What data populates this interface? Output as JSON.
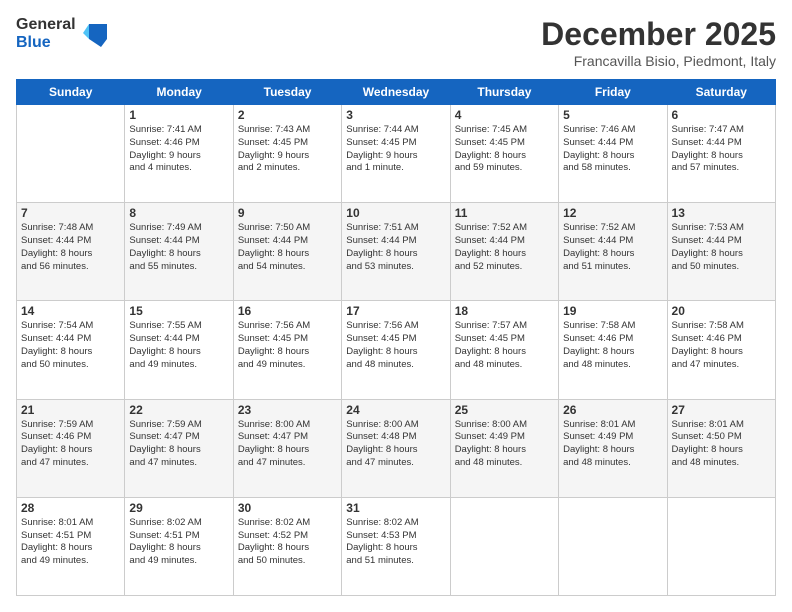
{
  "logo": {
    "general": "General",
    "blue": "Blue"
  },
  "header": {
    "month": "December 2025",
    "location": "Francavilla Bisio, Piedmont, Italy"
  },
  "weekdays": [
    "Sunday",
    "Monday",
    "Tuesday",
    "Wednesday",
    "Thursday",
    "Friday",
    "Saturday"
  ],
  "weeks": [
    [
      {
        "day": "",
        "info": ""
      },
      {
        "day": "1",
        "info": "Sunrise: 7:41 AM\nSunset: 4:46 PM\nDaylight: 9 hours\nand 4 minutes."
      },
      {
        "day": "2",
        "info": "Sunrise: 7:43 AM\nSunset: 4:45 PM\nDaylight: 9 hours\nand 2 minutes."
      },
      {
        "day": "3",
        "info": "Sunrise: 7:44 AM\nSunset: 4:45 PM\nDaylight: 9 hours\nand 1 minute."
      },
      {
        "day": "4",
        "info": "Sunrise: 7:45 AM\nSunset: 4:45 PM\nDaylight: 8 hours\nand 59 minutes."
      },
      {
        "day": "5",
        "info": "Sunrise: 7:46 AM\nSunset: 4:44 PM\nDaylight: 8 hours\nand 58 minutes."
      },
      {
        "day": "6",
        "info": "Sunrise: 7:47 AM\nSunset: 4:44 PM\nDaylight: 8 hours\nand 57 minutes."
      }
    ],
    [
      {
        "day": "7",
        "info": "Sunrise: 7:48 AM\nSunset: 4:44 PM\nDaylight: 8 hours\nand 56 minutes."
      },
      {
        "day": "8",
        "info": "Sunrise: 7:49 AM\nSunset: 4:44 PM\nDaylight: 8 hours\nand 55 minutes."
      },
      {
        "day": "9",
        "info": "Sunrise: 7:50 AM\nSunset: 4:44 PM\nDaylight: 8 hours\nand 54 minutes."
      },
      {
        "day": "10",
        "info": "Sunrise: 7:51 AM\nSunset: 4:44 PM\nDaylight: 8 hours\nand 53 minutes."
      },
      {
        "day": "11",
        "info": "Sunrise: 7:52 AM\nSunset: 4:44 PM\nDaylight: 8 hours\nand 52 minutes."
      },
      {
        "day": "12",
        "info": "Sunrise: 7:52 AM\nSunset: 4:44 PM\nDaylight: 8 hours\nand 51 minutes."
      },
      {
        "day": "13",
        "info": "Sunrise: 7:53 AM\nSunset: 4:44 PM\nDaylight: 8 hours\nand 50 minutes."
      }
    ],
    [
      {
        "day": "14",
        "info": "Sunrise: 7:54 AM\nSunset: 4:44 PM\nDaylight: 8 hours\nand 50 minutes."
      },
      {
        "day": "15",
        "info": "Sunrise: 7:55 AM\nSunset: 4:44 PM\nDaylight: 8 hours\nand 49 minutes."
      },
      {
        "day": "16",
        "info": "Sunrise: 7:56 AM\nSunset: 4:45 PM\nDaylight: 8 hours\nand 49 minutes."
      },
      {
        "day": "17",
        "info": "Sunrise: 7:56 AM\nSunset: 4:45 PM\nDaylight: 8 hours\nand 48 minutes."
      },
      {
        "day": "18",
        "info": "Sunrise: 7:57 AM\nSunset: 4:45 PM\nDaylight: 8 hours\nand 48 minutes."
      },
      {
        "day": "19",
        "info": "Sunrise: 7:58 AM\nSunset: 4:46 PM\nDaylight: 8 hours\nand 48 minutes."
      },
      {
        "day": "20",
        "info": "Sunrise: 7:58 AM\nSunset: 4:46 PM\nDaylight: 8 hours\nand 47 minutes."
      }
    ],
    [
      {
        "day": "21",
        "info": "Sunrise: 7:59 AM\nSunset: 4:46 PM\nDaylight: 8 hours\nand 47 minutes."
      },
      {
        "day": "22",
        "info": "Sunrise: 7:59 AM\nSunset: 4:47 PM\nDaylight: 8 hours\nand 47 minutes."
      },
      {
        "day": "23",
        "info": "Sunrise: 8:00 AM\nSunset: 4:47 PM\nDaylight: 8 hours\nand 47 minutes."
      },
      {
        "day": "24",
        "info": "Sunrise: 8:00 AM\nSunset: 4:48 PM\nDaylight: 8 hours\nand 47 minutes."
      },
      {
        "day": "25",
        "info": "Sunrise: 8:00 AM\nSunset: 4:49 PM\nDaylight: 8 hours\nand 48 minutes."
      },
      {
        "day": "26",
        "info": "Sunrise: 8:01 AM\nSunset: 4:49 PM\nDaylight: 8 hours\nand 48 minutes."
      },
      {
        "day": "27",
        "info": "Sunrise: 8:01 AM\nSunset: 4:50 PM\nDaylight: 8 hours\nand 48 minutes."
      }
    ],
    [
      {
        "day": "28",
        "info": "Sunrise: 8:01 AM\nSunset: 4:51 PM\nDaylight: 8 hours\nand 49 minutes."
      },
      {
        "day": "29",
        "info": "Sunrise: 8:02 AM\nSunset: 4:51 PM\nDaylight: 8 hours\nand 49 minutes."
      },
      {
        "day": "30",
        "info": "Sunrise: 8:02 AM\nSunset: 4:52 PM\nDaylight: 8 hours\nand 50 minutes."
      },
      {
        "day": "31",
        "info": "Sunrise: 8:02 AM\nSunset: 4:53 PM\nDaylight: 8 hours\nand 51 minutes."
      },
      {
        "day": "",
        "info": ""
      },
      {
        "day": "",
        "info": ""
      },
      {
        "day": "",
        "info": ""
      }
    ]
  ]
}
